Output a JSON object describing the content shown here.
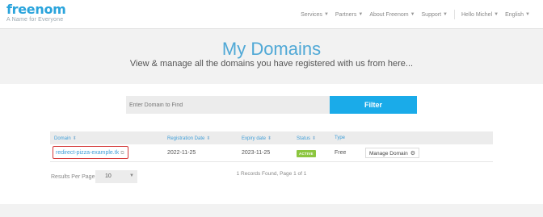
{
  "header": {
    "logo_word": "freenom",
    "logo_tagline": "A Name for Everyone",
    "nav": [
      {
        "label": "Services"
      },
      {
        "label": "Partners"
      },
      {
        "label": "About Freenom"
      },
      {
        "label": "Support"
      }
    ],
    "user_greeting": "Hello Michel",
    "language": "English"
  },
  "hero": {
    "title": "My Domains",
    "subtitle": "View & manage all the domains you have registered with us from here..."
  },
  "search": {
    "placeholder": "Enter Domain to Find",
    "button_label": "Filter"
  },
  "table": {
    "columns": {
      "domain": "Domain",
      "registration_date": "Registration Date",
      "expiry_date": "Expiry date",
      "status": "Status",
      "type": "Type"
    },
    "rows": [
      {
        "domain": "redirect-pizza-example.tk",
        "registration_date": "2022-11-25",
        "expiry_date": "2023-11-25",
        "status": "ACTIVE",
        "type": "Free",
        "action": "Manage Domain"
      }
    ]
  },
  "pagination": {
    "results_per_page_label": "Results Per Page:",
    "results_per_page_value": "10",
    "records_text": "1 Records Found, Page 1 of 1"
  },
  "colors": {
    "accent": "#1aabe9",
    "title_blue": "#4fa8d6",
    "active_green": "#8cc63f",
    "highlight_red": "#d43a3a"
  }
}
